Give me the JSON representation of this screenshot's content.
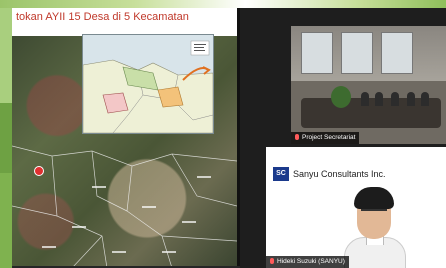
{
  "shared_screen": {
    "slide_title": "tokan AYII 15 Desa di 5 Kecamatan"
  },
  "participants": [
    {
      "name": "Project Secretariat"
    },
    {
      "name": "Hideki Suzuki (SANYU)"
    }
  ],
  "company_logo": {
    "text": "SC"
  },
  "company_name": "Sanyu Consultants Inc.",
  "colors": {
    "slide_title": "#c0392b",
    "logo_blue": "#1b3a8c",
    "mic_muted": "#ff5a5a"
  }
}
